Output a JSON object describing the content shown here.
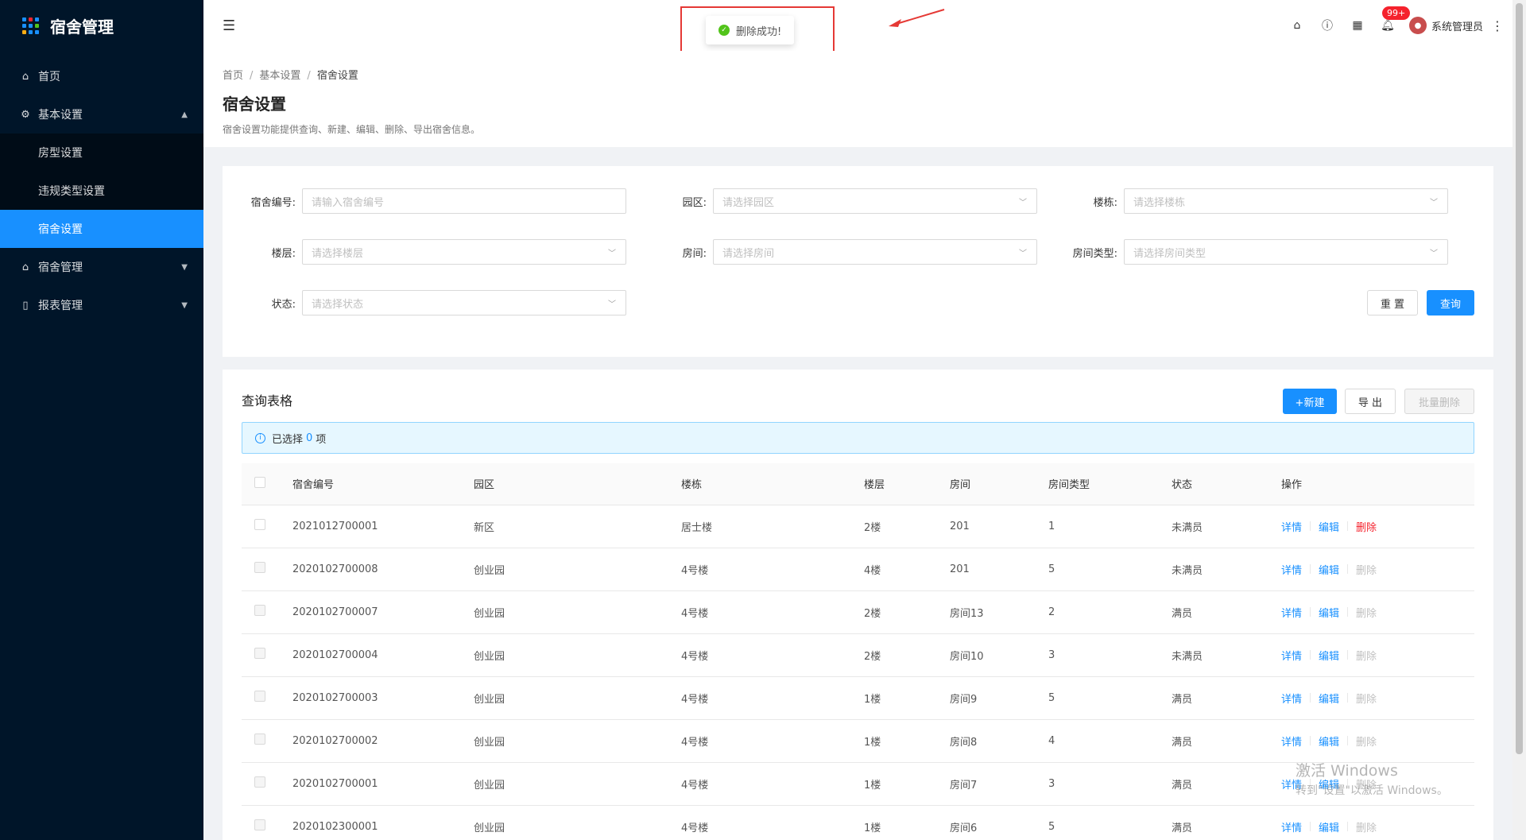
{
  "app": {
    "title": "宿舍管理"
  },
  "sidebar": {
    "items": [
      {
        "label": "首页"
      },
      {
        "label": "基本设置"
      },
      {
        "label": "房型设置"
      },
      {
        "label": "违规类型设置"
      },
      {
        "label": "宿舍设置"
      },
      {
        "label": "宿舍管理"
      },
      {
        "label": "报表管理"
      }
    ]
  },
  "header": {
    "badge": "99+",
    "username": "系统管理员"
  },
  "toast": {
    "message": "删除成功!"
  },
  "breadcrumb": [
    "首页",
    "基本设置",
    "宿舍设置"
  ],
  "page": {
    "title": "宿舍设置",
    "description": "宿舍设置功能提供查询、新建、编辑、删除、导出宿舍信息。"
  },
  "filters": {
    "dorm_no": {
      "label": "宿舍编号:",
      "placeholder": "请输入宿舍编号"
    },
    "park": {
      "label": "园区:",
      "placeholder": "请选择园区"
    },
    "building": {
      "label": "楼栋:",
      "placeholder": "请选择楼栋"
    },
    "floor": {
      "label": "楼层:",
      "placeholder": "请选择楼层"
    },
    "room": {
      "label": "房间:",
      "placeholder": "请选择房间"
    },
    "room_type": {
      "label": "房间类型:",
      "placeholder": "请选择房间类型"
    },
    "status": {
      "label": "状态:",
      "placeholder": "请选择状态"
    },
    "reset_label": "重 置",
    "query_label": "查询"
  },
  "table": {
    "title": "查询表格",
    "new_label": "+新建",
    "export_label": "导 出",
    "batch_delete_label": "批量删除",
    "selected_prefix": "已选择",
    "selected_count": "0",
    "selected_suffix": "项",
    "columns": [
      "宿舍编号",
      "园区",
      "楼栋",
      "楼层",
      "房间",
      "房间类型",
      "状态",
      "操作"
    ],
    "action_labels": {
      "detail": "详情",
      "edit": "编辑",
      "delete": "删除"
    },
    "rows": [
      {
        "no": "2021012700001",
        "park": "新区",
        "building": "居士楼",
        "floor": "2楼",
        "room": "201",
        "type": "1",
        "status": "未满员",
        "deletable": true
      },
      {
        "no": "2020102700008",
        "park": "创业园",
        "building": "4号楼",
        "floor": "4楼",
        "room": "201",
        "type": "5",
        "status": "未满员",
        "deletable": false
      },
      {
        "no": "2020102700007",
        "park": "创业园",
        "building": "4号楼",
        "floor": "2楼",
        "room": "房间13",
        "type": "2",
        "status": "满员",
        "deletable": false
      },
      {
        "no": "2020102700004",
        "park": "创业园",
        "building": "4号楼",
        "floor": "2楼",
        "room": "房间10",
        "type": "3",
        "status": "未满员",
        "deletable": false
      },
      {
        "no": "2020102700003",
        "park": "创业园",
        "building": "4号楼",
        "floor": "1楼",
        "room": "房间9",
        "type": "5",
        "status": "满员",
        "deletable": false
      },
      {
        "no": "2020102700002",
        "park": "创业园",
        "building": "4号楼",
        "floor": "1楼",
        "room": "房间8",
        "type": "4",
        "status": "满员",
        "deletable": false
      },
      {
        "no": "2020102700001",
        "park": "创业园",
        "building": "4号楼",
        "floor": "1楼",
        "room": "房间7",
        "type": "3",
        "status": "满员",
        "deletable": false
      },
      {
        "no": "2020102300001",
        "park": "创业园",
        "building": "4号楼",
        "floor": "1楼",
        "room": "房间6",
        "type": "5",
        "status": "满员",
        "deletable": false
      }
    ]
  },
  "watermark": {
    "line1": "激活 Windows",
    "line2": "转到\"设置\"以激活 Windows。"
  }
}
